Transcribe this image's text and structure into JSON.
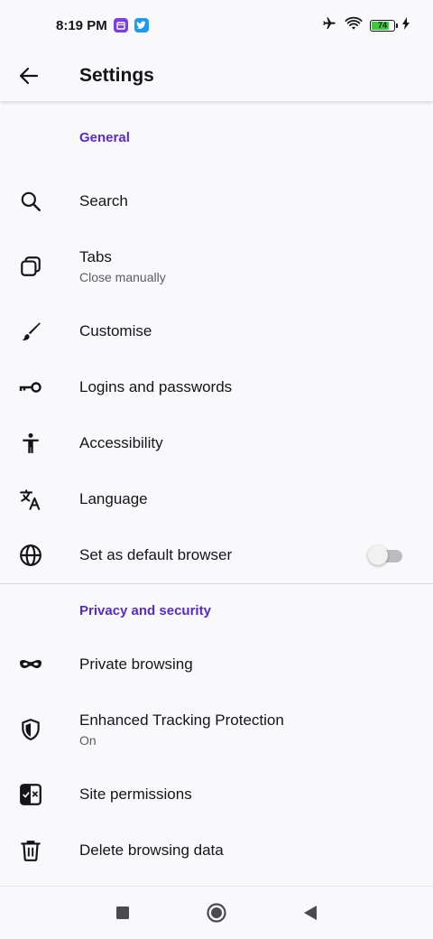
{
  "status_bar": {
    "time": "8:19 PM",
    "battery_level": "74",
    "notification_icons": [
      "calendar-app-icon",
      "twitter-app-icon"
    ],
    "status_icons": [
      "airplane-mode-icon",
      "wifi-icon",
      "battery-icon",
      "charging-icon"
    ]
  },
  "toolbar": {
    "title": "Settings",
    "back_icon": "arrow-left-icon"
  },
  "sections": {
    "general": {
      "header": "General",
      "search": {
        "title": "Search",
        "icon": "search-icon"
      },
      "tabs": {
        "title": "Tabs",
        "subtitle": "Close manually",
        "icon": "tabs-icon"
      },
      "customise": {
        "title": "Customise",
        "icon": "brush-icon"
      },
      "logins": {
        "title": "Logins and passwords",
        "icon": "key-icon"
      },
      "accessibility": {
        "title": "Accessibility",
        "icon": "accessibility-icon"
      },
      "language": {
        "title": "Language",
        "icon": "translate-icon"
      },
      "default_browser": {
        "title": "Set as default browser",
        "icon": "globe-icon",
        "toggle_on": false
      }
    },
    "privacy": {
      "header": "Privacy and security",
      "private_browsing": {
        "title": "Private browsing",
        "icon": "mask-icon"
      },
      "tracking_protection": {
        "title": "Enhanced Tracking Protection",
        "subtitle": "On",
        "icon": "shield-icon"
      },
      "site_permissions": {
        "title": "Site permissions",
        "icon": "permissions-icon"
      },
      "delete_data": {
        "title": "Delete browsing data",
        "icon": "trash-icon"
      }
    }
  },
  "colors": {
    "accent": "#592acb",
    "background": "#f9f9fb",
    "text_primary": "#15141a",
    "text_secondary": "#5b5b66",
    "battery_fill": "#3fc73f"
  },
  "nav_bar": {
    "buttons": [
      "recents-square-icon",
      "home-circle-icon",
      "back-triangle-icon"
    ]
  }
}
